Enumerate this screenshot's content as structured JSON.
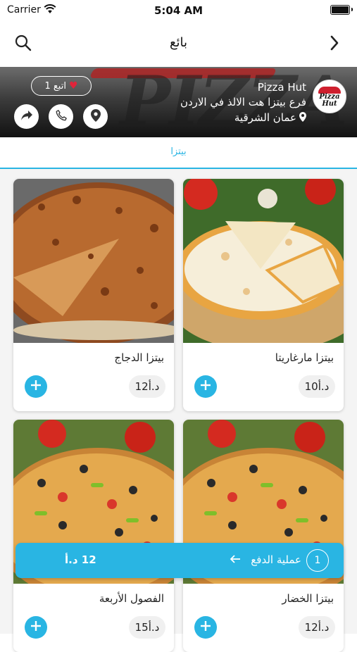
{
  "status_bar": {
    "carrier": "Carrier",
    "time": "5:04 AM"
  },
  "nav": {
    "title": "بائع"
  },
  "store": {
    "name": "Pizza Hut",
    "branch": "فرع بيتزا هت الالذ في الاردن",
    "location": "عمان الشرقية",
    "follow_label": "اتبع 1",
    "logo_text_1": "Pizza",
    "logo_text_2": "Hut",
    "banner_word": "PIZZA"
  },
  "tabs": [
    {
      "label": "بيتزا"
    }
  ],
  "products": [
    {
      "name": "بيتزا مارغاريتا",
      "price": "د.أ10"
    },
    {
      "name": "بيتزا الدجاج",
      "price": "د.أ12"
    },
    {
      "name": "بيتزا الخضار",
      "price": "د.أ12"
    },
    {
      "name": "الفصول الأربعة",
      "price": "د.أ15"
    }
  ],
  "checkout": {
    "count": "1",
    "label": "عملية الدفع",
    "total": "12 د.أ"
  },
  "colors": {
    "accent": "#29b5e3",
    "heart": "#e0243a"
  }
}
